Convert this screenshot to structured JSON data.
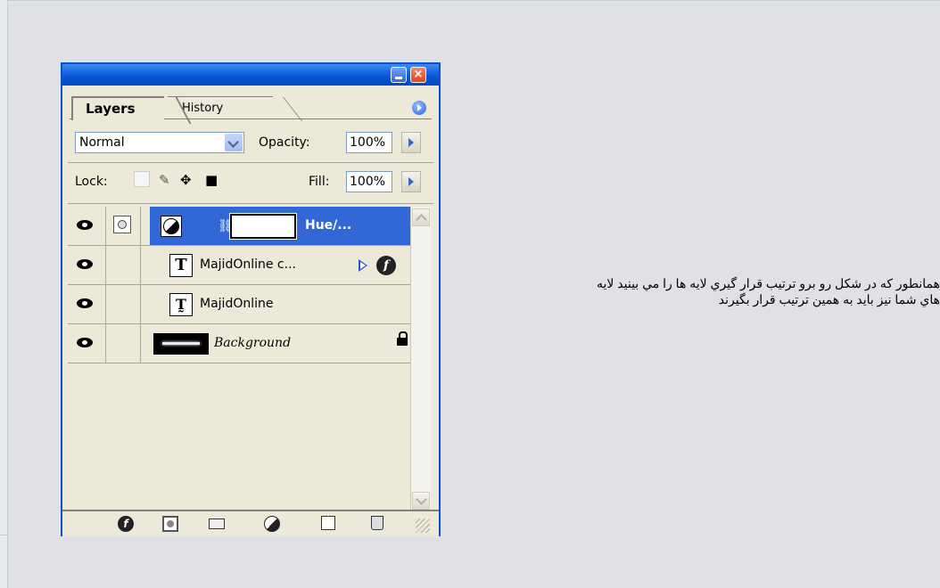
{
  "palette": {
    "tabs": {
      "layers": "Layers",
      "history": "History"
    },
    "blend_mode": "Normal",
    "opacity_label": "Opacity:",
    "opacity_value": "100%",
    "lock_label": "Lock:",
    "fill_label": "Fill:",
    "fill_value": "100%",
    "layers": [
      {
        "name": "Hue/...",
        "selected": true
      },
      {
        "name": "MajidOnline c..."
      },
      {
        "name": "MajidOnline"
      },
      {
        "name": "Background"
      }
    ],
    "close_glyph": "×"
  },
  "message": {
    "line1": "همانطور که در شکل رو برو ترتيب قرار گيري لايه ها را مي بينيد لايه",
    "line2": "هاي شما نيز بايد به همين ترتيب قرار بگيرند"
  }
}
